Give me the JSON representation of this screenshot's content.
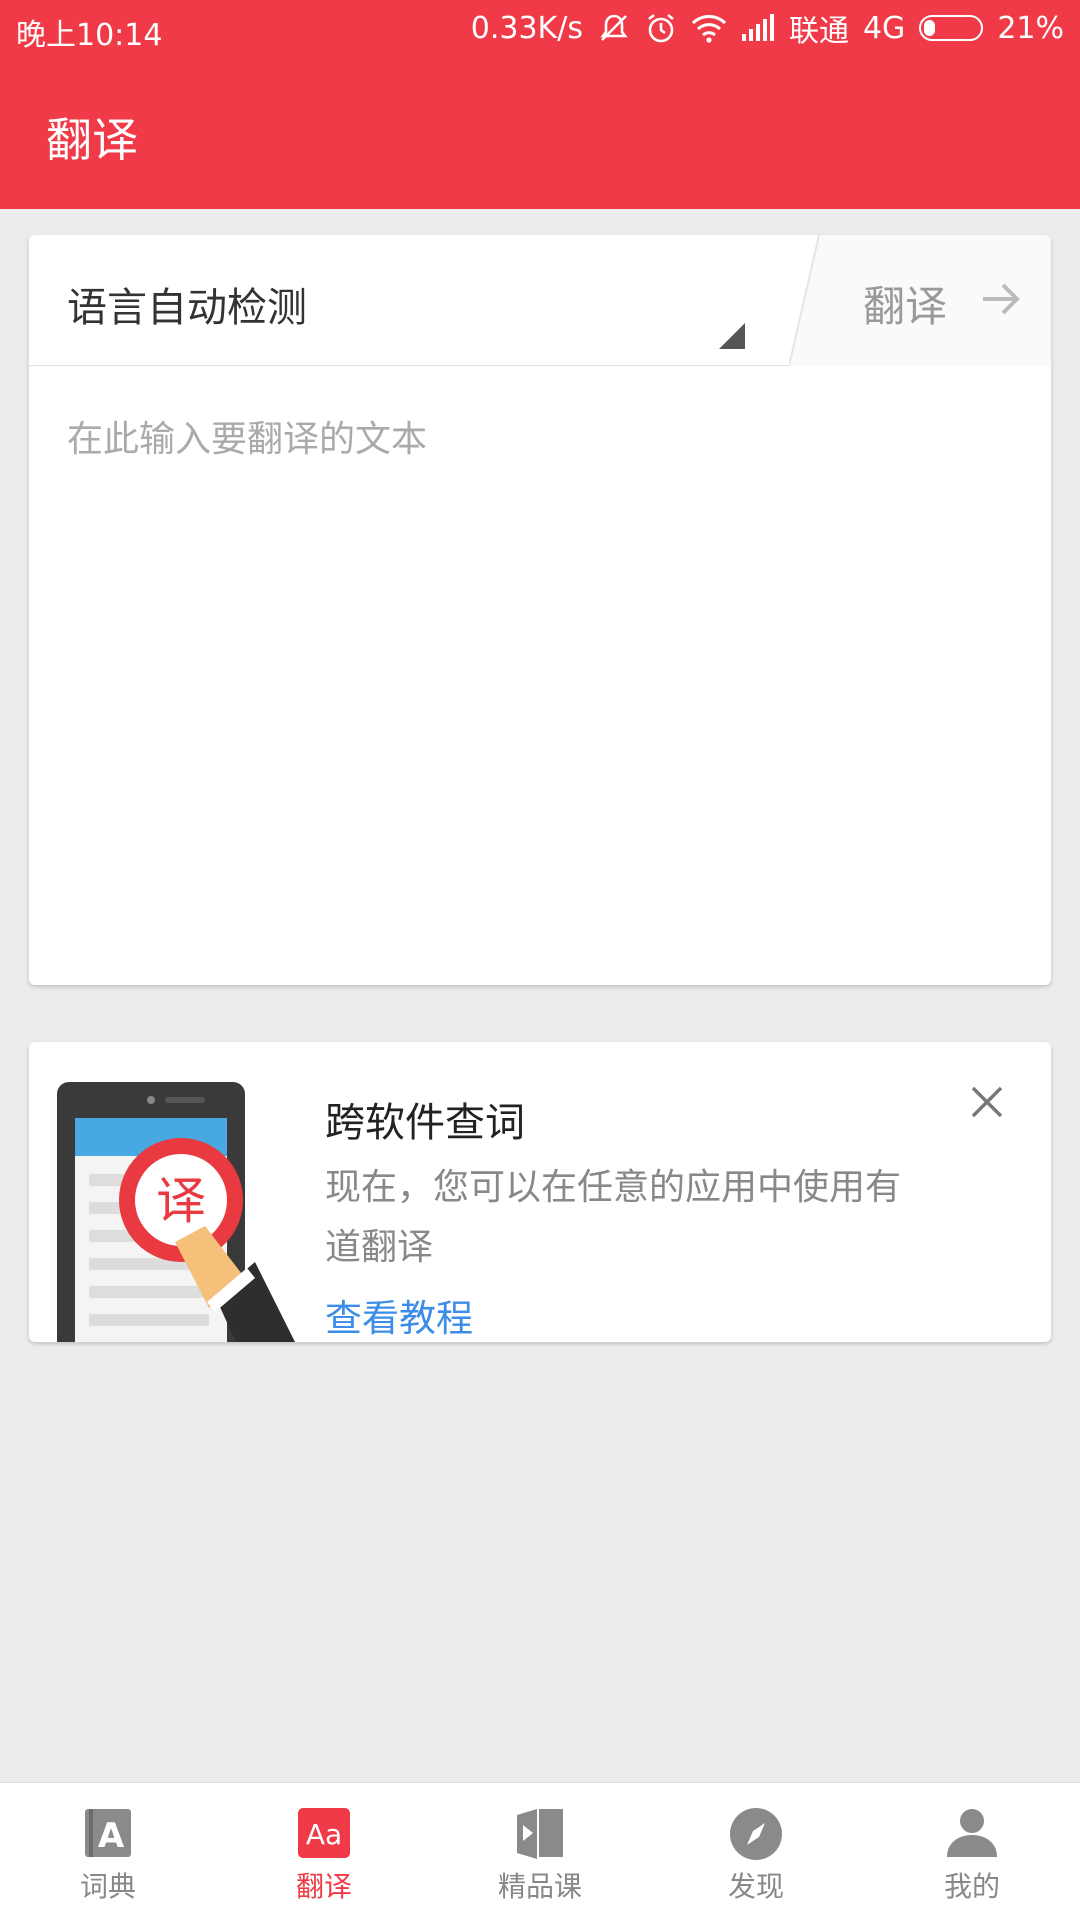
{
  "status_bar": {
    "time": "晚上10:14",
    "speed": "0.33K/s",
    "carrier": "联通",
    "network": "4G",
    "battery": "21%",
    "battery_level": 0.21
  },
  "app_bar": {
    "title": "翻译"
  },
  "translate": {
    "language": "语言自动检测",
    "go_label": "翻译",
    "placeholder": "在此输入要翻译的文本"
  },
  "promo": {
    "badge": "译",
    "title": "跨软件查词",
    "desc": "现在，您可以在任意的应用中使用有道翻译",
    "link": "查看教程"
  },
  "nav": {
    "items": [
      {
        "label": "词典",
        "icon": "dictionary-icon"
      },
      {
        "label": "翻译",
        "icon": "translate-icon",
        "glyph": "Aa"
      },
      {
        "label": "精品课",
        "icon": "course-icon"
      },
      {
        "label": "发现",
        "icon": "compass-icon"
      },
      {
        "label": "我的",
        "icon": "profile-icon"
      }
    ],
    "active_index": 1
  },
  "colors": {
    "brand": "#f03a47",
    "link": "#3b8de8",
    "background": "#ececec"
  }
}
